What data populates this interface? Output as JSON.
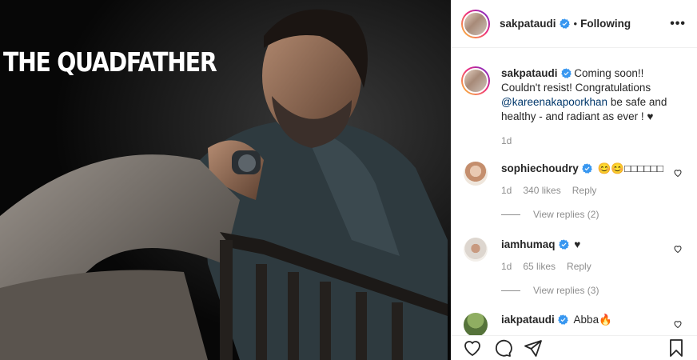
{
  "post": {
    "image_title": "THE QUADFATHER"
  },
  "header": {
    "username": "sakpataudi",
    "dot": "•",
    "follow_status": "Following",
    "more": "•••"
  },
  "caption": {
    "username": "sakpataudi",
    "text_before": "Coming soon!! Couldn't resist! Congratulations",
    "mention": "@kareenakapoorkhan",
    "text_after": "be safe and healthy - and radiant as ever ! ♥",
    "time": "1d"
  },
  "comments": [
    {
      "username": "sophiechoudry",
      "text": "😊😊□□□□□□",
      "time": "1d",
      "likes": "340 likes",
      "reply": "Reply",
      "view_replies": "View replies (2)"
    },
    {
      "username": "iamhumaq",
      "text": "♥",
      "time": "1d",
      "likes": "65 likes",
      "reply": "Reply",
      "view_replies": "View replies (3)"
    },
    {
      "username": "iakpataudi",
      "text": "Abba🔥"
    }
  ],
  "colors": {
    "link": "#00376b",
    "verified": "#3897f0",
    "muted": "#8e8e8e"
  },
  "icons": [
    "heart-icon",
    "comment-icon",
    "share-icon",
    "bookmark-icon",
    "verified-icon",
    "more-icon"
  ]
}
